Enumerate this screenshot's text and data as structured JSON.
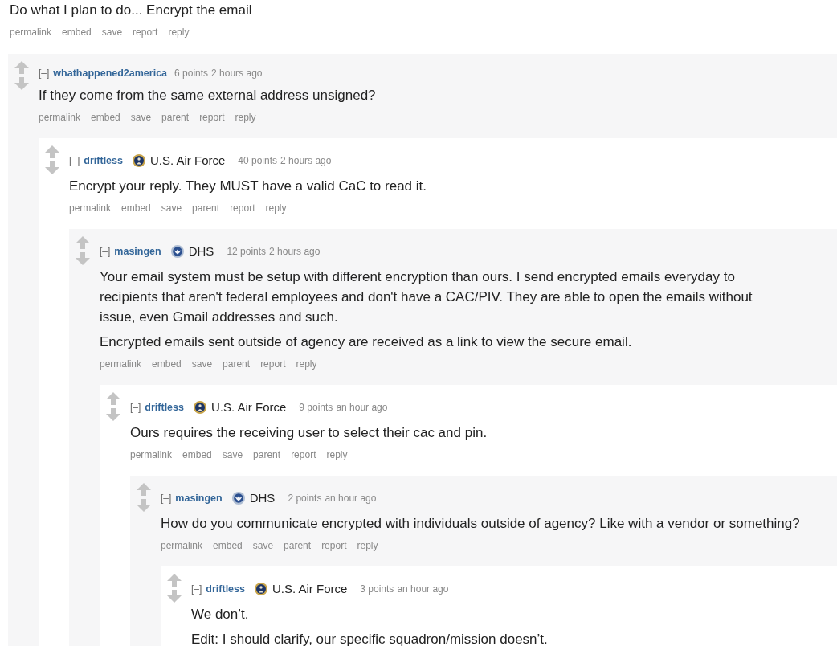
{
  "thread": {
    "body": [
      "Do what I plan to do... Encrypt the email"
    ],
    "actions": [
      "permalink",
      "embed",
      "save",
      "report",
      "reply"
    ],
    "children": [
      {
        "collapse": "[–]",
        "author": "whathappened2america",
        "score": "6 points",
        "time": "2 hours ago",
        "body": [
          "If they come from the same external address unsigned?"
        ],
        "actions": [
          "permalink",
          "embed",
          "save",
          "parent",
          "report",
          "reply"
        ],
        "children": [
          {
            "collapse": "[–]",
            "author": "driftless",
            "flair": {
              "kind": "air_force",
              "text": "U.S. Air Force"
            },
            "score": "40 points",
            "time": "2 hours ago",
            "body": [
              "Encrypt your reply. They MUST have a valid CaC to read it."
            ],
            "actions": [
              "permalink",
              "embed",
              "save",
              "parent",
              "report",
              "reply"
            ],
            "children": [
              {
                "collapse": "[–]",
                "author": "masingen",
                "flair": {
                  "kind": "dhs",
                  "text": "DHS"
                },
                "score": "12 points",
                "time": "2 hours ago",
                "body": [
                  "Your email system must be setup with different encryption than ours. I send encrypted emails everyday to recipients that aren't federal employees and don't have a CAC/PIV. They are able to open the emails without issue, even Gmail addresses and such.",
                  "Encrypted emails sent outside of agency are received as a link to view the secure email."
                ],
                "actions": [
                  "permalink",
                  "embed",
                  "save",
                  "parent",
                  "report",
                  "reply"
                ],
                "children": [
                  {
                    "collapse": "[–]",
                    "author": "driftless",
                    "flair": {
                      "kind": "air_force",
                      "text": "U.S. Air Force"
                    },
                    "score": "9 points",
                    "time": "an hour ago",
                    "body": [
                      "Ours requires the receiving user to select their cac and pin."
                    ],
                    "actions": [
                      "permalink",
                      "embed",
                      "save",
                      "parent",
                      "report",
                      "reply"
                    ],
                    "children": [
                      {
                        "collapse": "[–]",
                        "author": "masingen",
                        "flair": {
                          "kind": "dhs",
                          "text": "DHS"
                        },
                        "score": "2 points",
                        "time": "an hour ago",
                        "body": [
                          "How do you communicate encrypted with individuals outside of agency? Like with a vendor or something?"
                        ],
                        "actions": [
                          "permalink",
                          "embed",
                          "save",
                          "parent",
                          "report",
                          "reply"
                        ],
                        "children": [
                          {
                            "collapse": "[–]",
                            "author": "driftless",
                            "flair": {
                              "kind": "air_force",
                              "text": "U.S. Air Force"
                            },
                            "score": "3 points",
                            "time": "an hour ago",
                            "body": [
                              "We don’t.",
                              "Edit: I should clarify, our specific squadron/mission doesn’t."
                            ]
                          }
                        ]
                      }
                    ]
                  }
                ]
              }
            ]
          }
        ]
      }
    ]
  }
}
